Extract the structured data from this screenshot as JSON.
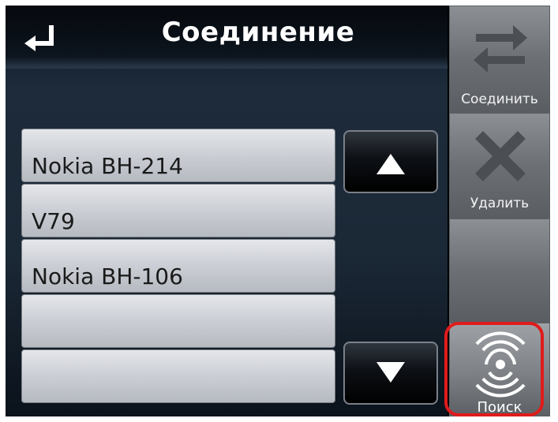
{
  "header": {
    "title": "Соединение"
  },
  "devices": [
    {
      "name": "Nokia BH-214"
    },
    {
      "name": "V79"
    },
    {
      "name": "Nokia BH-106"
    },
    {
      "name": ""
    },
    {
      "name": ""
    }
  ],
  "sidebar": {
    "connect_label": "Соединить",
    "delete_label": "Удалить",
    "search_label": "Поиск"
  },
  "colors": {
    "highlight": "#e01b1b",
    "title_text": "#ffffff"
  }
}
